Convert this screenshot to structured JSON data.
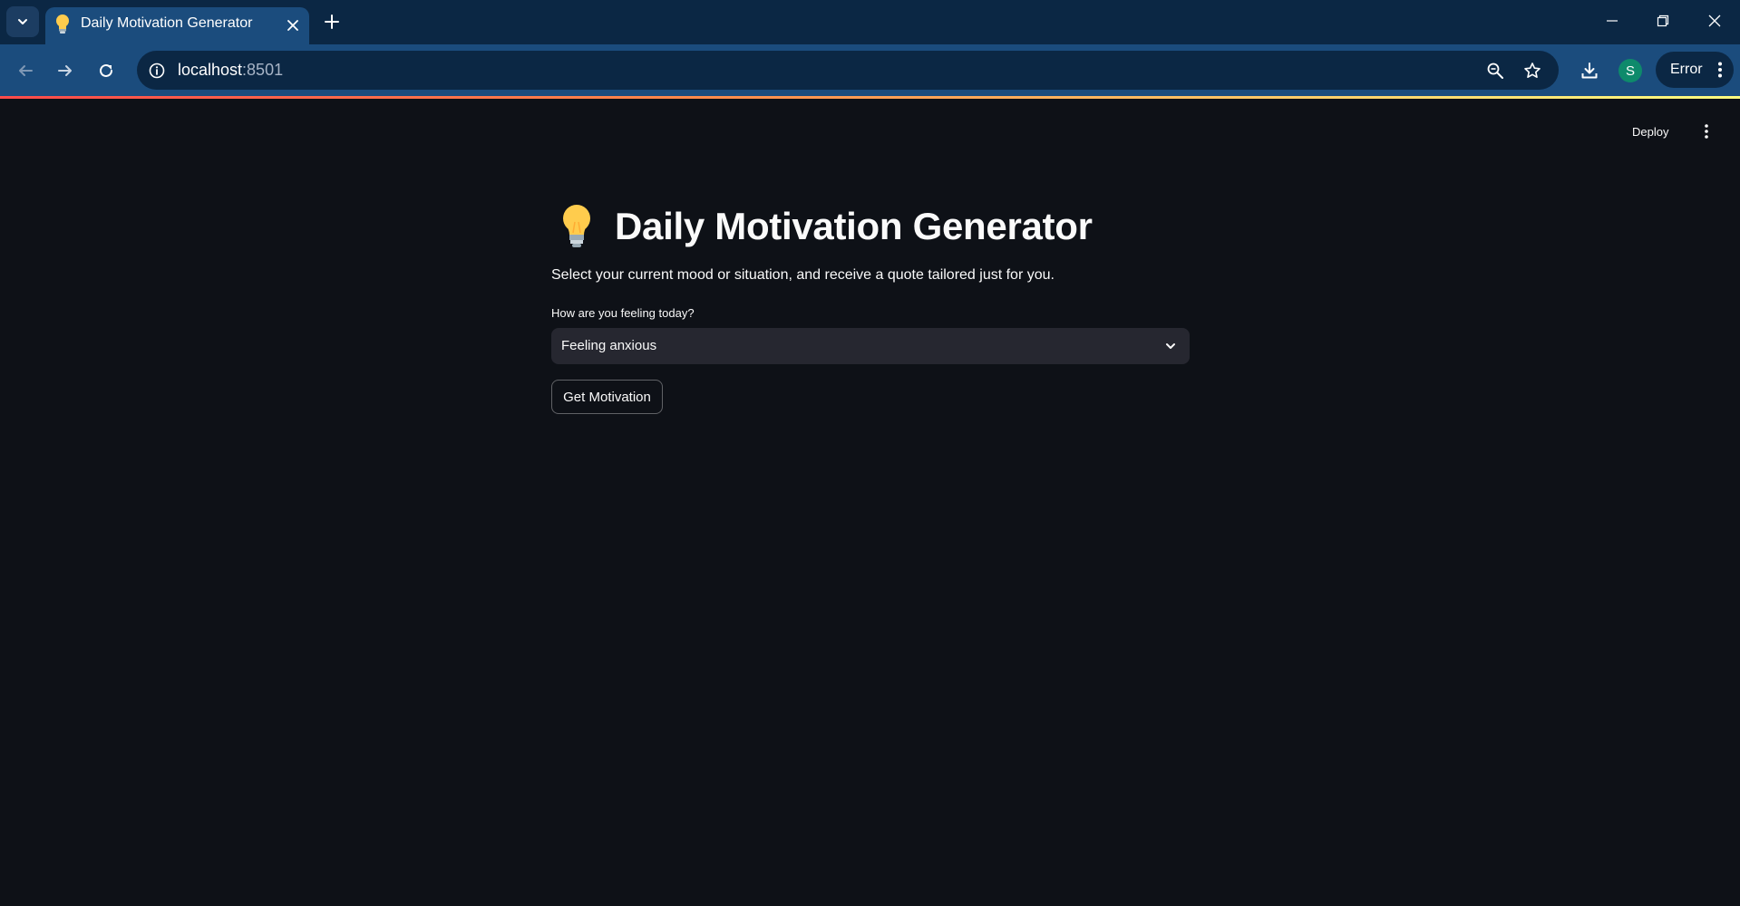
{
  "browser": {
    "tab": {
      "title": "Daily Motivation Generator",
      "favicon": "lightbulb-icon"
    },
    "address": {
      "host": "localhost",
      "port": ":8501"
    },
    "profile_initial": "S",
    "error_label": "Error",
    "icons": [
      "tab-search-icon",
      "close-icon",
      "plus-icon",
      "minimize-icon",
      "restore-icon",
      "window-close-icon",
      "back-arrow-icon",
      "forward-arrow-icon",
      "reload-icon",
      "site-info-icon",
      "zoom-icon",
      "star-icon",
      "download-icon",
      "kebab-menu-icon"
    ]
  },
  "app": {
    "header": {
      "deploy_label": "Deploy"
    },
    "title": "Daily Motivation Generator",
    "title_icon": "lightbulb-icon",
    "subtitle": "Select your current mood or situation, and receive a quote tailored just for you.",
    "mood_select": {
      "label": "How are you feeling today?",
      "value": "Feeling anxious"
    },
    "submit_button": "Get Motivation"
  },
  "colors": {
    "app_background": "#0e1117",
    "select_background": "#262730",
    "text": "#fafafa",
    "tabstrip": "#0b2744",
    "toolbar": "#1b4c7d",
    "profile_avatar": "#0e8a6b"
  }
}
